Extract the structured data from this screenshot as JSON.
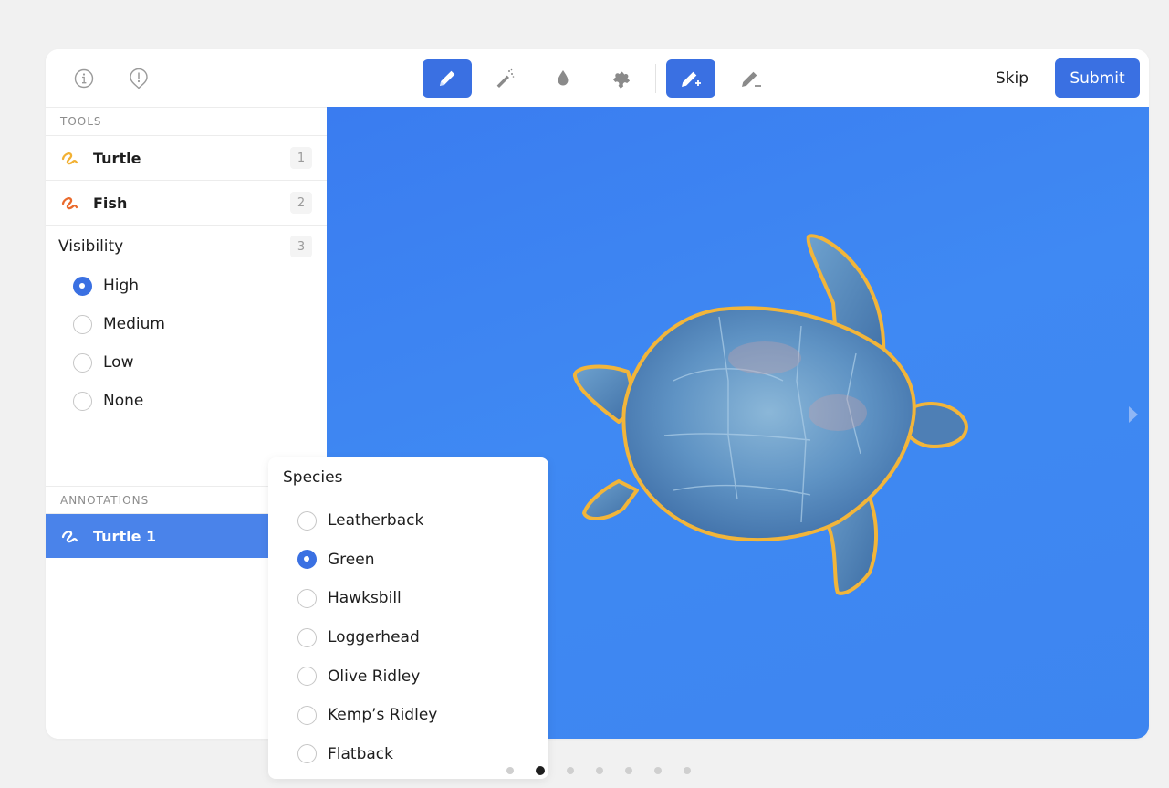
{
  "toolbar": {
    "left_icons": [
      "info-icon",
      "warning-icon"
    ],
    "tools": [
      {
        "name": "pencil-tool",
        "icon": "pencil-icon",
        "active": true
      },
      {
        "name": "magic-wand-tool",
        "icon": "magic-wand-icon",
        "active": false
      },
      {
        "name": "drop-tool",
        "icon": "drop-icon",
        "active": false
      },
      {
        "name": "puzzle-tool",
        "icon": "puzzle-icon",
        "active": false
      },
      {
        "name": "add-point-tool",
        "icon": "pencil-plus-icon",
        "active": true
      },
      {
        "name": "remove-point-tool",
        "icon": "pencil-minus-icon",
        "active": false
      }
    ],
    "skip_label": "Skip",
    "submit_label": "Submit"
  },
  "sidebar": {
    "tools_header": "TOOLS",
    "tools": [
      {
        "label": "Turtle",
        "key": "1",
        "color": "#f2b134"
      },
      {
        "label": "Fish",
        "key": "2",
        "color": "#ea6a2c"
      }
    ],
    "visibility": {
      "title": "Visibility",
      "key": "3",
      "options": [
        {
          "label": "High",
          "checked": true
        },
        {
          "label": "Medium",
          "checked": false
        },
        {
          "label": "Low",
          "checked": false
        },
        {
          "label": "None",
          "checked": false
        }
      ]
    },
    "annotations_header": "ANNOTATIONS",
    "annotations": [
      {
        "label": "Turtle 1"
      }
    ]
  },
  "species": {
    "title": "Species",
    "options": [
      {
        "label": "Leatherback",
        "checked": false
      },
      {
        "label": "Green",
        "checked": true
      },
      {
        "label": "Hawksbill",
        "checked": false
      },
      {
        "label": "Loggerhead",
        "checked": false
      },
      {
        "label": "Olive Ridley",
        "checked": false
      },
      {
        "label": "Kemp’s Ridley",
        "checked": false
      },
      {
        "label": "Flatback",
        "checked": false
      }
    ]
  },
  "pager": {
    "count": 7,
    "active_index": 1
  },
  "colors": {
    "accent": "#3a70e2",
    "canvas_blue": "#3d85f0",
    "outline_yellow": "#f2b53a"
  }
}
